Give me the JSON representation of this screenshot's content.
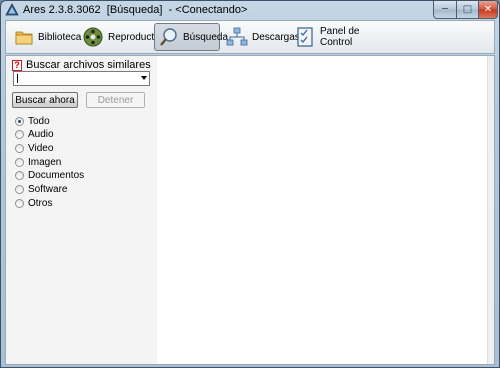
{
  "window": {
    "title": "Ares 2.3.8.3062  [Búsqueda]  - <Conectando>",
    "minimize_symbol": "─",
    "maximize_symbol": "□",
    "close_symbol": "✕"
  },
  "toolbar": {
    "items": [
      {
        "label": "Biblioteca",
        "icon": "folder-icon",
        "active": false
      },
      {
        "label": "Reproductor",
        "icon": "film-reel-icon",
        "active": false
      },
      {
        "label": "Búsqueda",
        "icon": "magnifier-icon",
        "active": true
      },
      {
        "label": "Descargas",
        "icon": "network-icon",
        "active": false
      },
      {
        "label": "Panel de Control",
        "icon": "checklist-icon",
        "active": false
      }
    ]
  },
  "search": {
    "similar_label": "Buscar archivos similares",
    "query_value": "",
    "search_button": "Buscar ahora",
    "stop_button": "Detener",
    "types": [
      {
        "label": "Todo",
        "checked": true
      },
      {
        "label": "Audio",
        "checked": false
      },
      {
        "label": "Video",
        "checked": false
      },
      {
        "label": "Imagen",
        "checked": false
      },
      {
        "label": "Documentos",
        "checked": false
      },
      {
        "label": "Software",
        "checked": false
      },
      {
        "label": "Otros",
        "checked": false
      }
    ]
  },
  "colors": {
    "accent": "#1f4f8a",
    "close_red": "#c5341c",
    "frame": "#a9bfd4"
  }
}
